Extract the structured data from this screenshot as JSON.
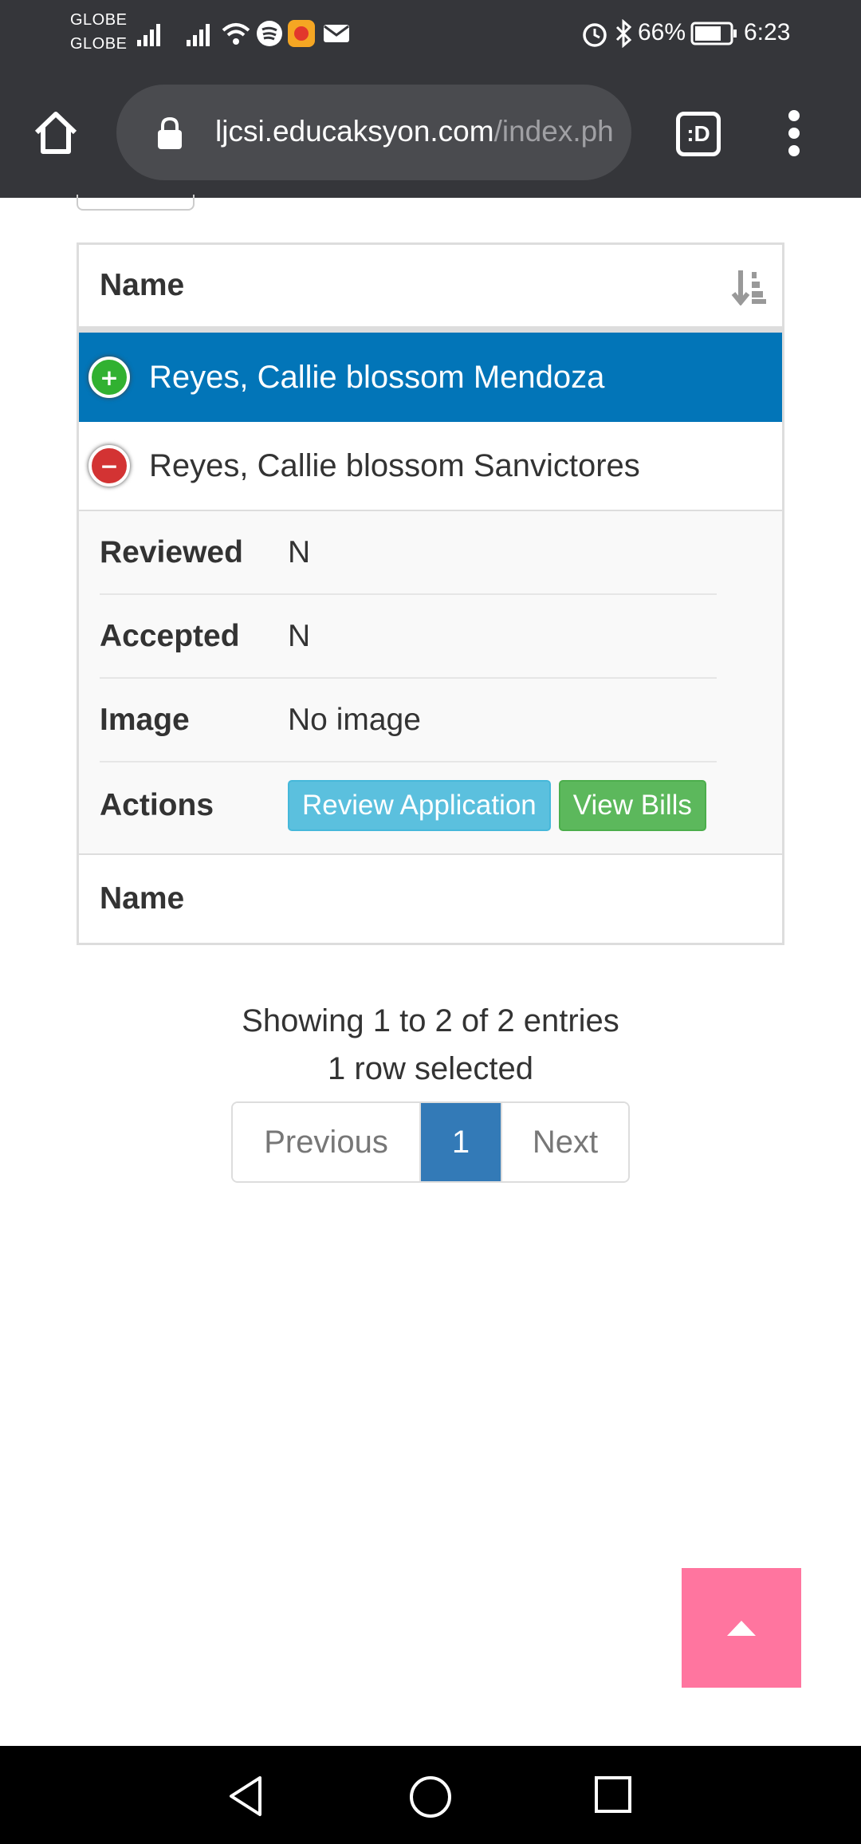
{
  "status_bar": {
    "carrier_1": "GLOBE",
    "carrier_2": "GLOBE",
    "battery": "66%",
    "time": "6:23",
    "icons": [
      "signal-icon",
      "signal-icon",
      "wifi-icon",
      "spotify-icon",
      "app-icon",
      "mail-icon",
      "alarm-icon",
      "bluetooth-icon",
      "battery-icon"
    ]
  },
  "browser": {
    "url_host": "ljcsi.educaksyon.com",
    "url_path": "/index.ph",
    "tabs_label": ":D"
  },
  "table": {
    "header": "Name",
    "footer": "Name",
    "rows": [
      {
        "name": "Reyes, Callie blossom Mendoza",
        "selected": true,
        "control": "+"
      },
      {
        "name": "Reyes, Callie blossom Sanvictores",
        "selected": false,
        "control": "−"
      }
    ],
    "details": {
      "reviewed_label": "Reviewed",
      "reviewed_value": "N",
      "accepted_label": "Accepted",
      "accepted_value": "N",
      "image_label": "Image",
      "image_value": "No image",
      "actions_label": "Actions",
      "review_button": "Review Application",
      "bills_button": "View Bills"
    }
  },
  "info": {
    "entries": "Showing 1 to 2 of 2 entries",
    "selected": "1 row selected"
  },
  "pagination": {
    "previous": "Previous",
    "current": "1",
    "next": "Next"
  },
  "colors": {
    "selected_row": "#0275b8",
    "scroll_top_button": "#ff759f",
    "info_button": "#5bc0de",
    "success_button": "#5cb85c"
  }
}
